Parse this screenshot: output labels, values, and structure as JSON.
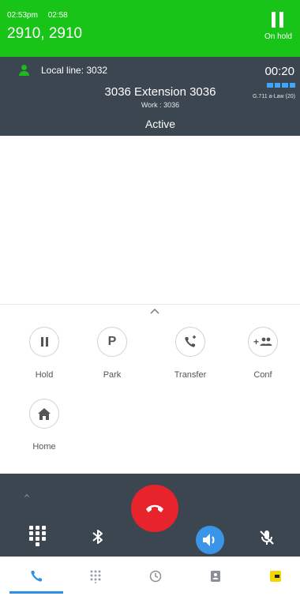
{
  "held_call": {
    "time": "02:53pm",
    "duration": "02:58",
    "names": "2910, 2910",
    "hold_label": "On hold",
    "color": "#17c417"
  },
  "active_call": {
    "local_line": "Local line: 3032",
    "timer": "00:20",
    "contact_name": "3036 Extension 3036",
    "contact_number": "Work : 3036",
    "status": "Active",
    "codec": "G.711 a-Law (20)",
    "line_icon": "person-icon",
    "quality_icon": "signal-quality-icon"
  },
  "actions": {
    "hold": "Hold",
    "park": "Park",
    "park_letter": "P",
    "transfer": "Transfer",
    "conf": "Conf",
    "conf_symbol": "+",
    "home": "Home"
  },
  "call_bar": {
    "hangup_icon": "hangup-icon",
    "keypad_icon": "dialpad-icon",
    "bluetooth_icon": "bluetooth-icon",
    "speaker_icon": "speaker-icon",
    "mute_icon": "microphone-mute-icon",
    "hangup_color": "#e7242b",
    "speaker_color": "#3a95e8"
  },
  "nav": {
    "tabs": [
      "phone-icon",
      "dialpad-icon",
      "clock-icon",
      "contacts-icon",
      "voicemail-icon"
    ],
    "active_color": "#2d8fe7"
  }
}
